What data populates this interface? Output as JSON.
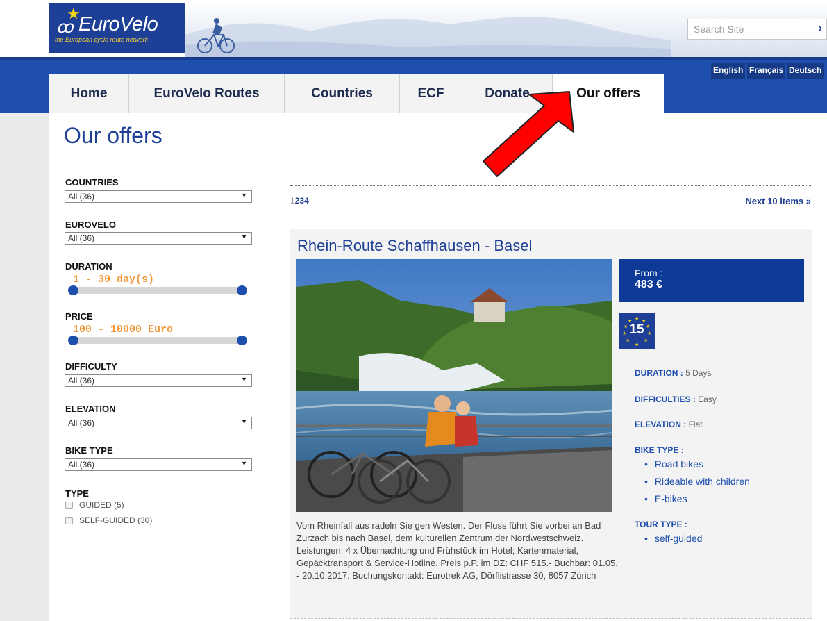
{
  "header": {
    "logo_text": "EuroVelo",
    "logo_tagline": "the European cycle route network",
    "search_placeholder": "Search Site",
    "languages": [
      "English",
      "Français",
      "Deutsch"
    ]
  },
  "nav": {
    "items": [
      {
        "label": "Home"
      },
      {
        "label": "EuroVelo Routes"
      },
      {
        "label": "Countries"
      },
      {
        "label": "ECF"
      },
      {
        "label": "Donate"
      },
      {
        "label": "Our offers",
        "active": true
      }
    ]
  },
  "page": {
    "title": "Our offers"
  },
  "filters": {
    "countries": {
      "label": "COUNTRIES",
      "value": "All (36)"
    },
    "eurovelo": {
      "label": "EUROVELO",
      "value": "All (36)"
    },
    "duration": {
      "label": "DURATION",
      "range_text": "1 - 30 day(s)",
      "min": 1,
      "max": 30
    },
    "price": {
      "label": "PRICE",
      "range_text": "100 - 10000 Euro",
      "min": 100,
      "max": 10000
    },
    "difficulty": {
      "label": "DIFFICULTY",
      "value": "All (36)"
    },
    "elevation": {
      "label": "ELEVATION",
      "value": "All (36)"
    },
    "bike_type": {
      "label": "BIKE TYPE",
      "value": "All (36)"
    },
    "type": {
      "label": "TYPE",
      "options": [
        {
          "label": "GUIDED (5)",
          "checked": false
        },
        {
          "label": "SELF-GUIDED (30)",
          "checked": false
        }
      ]
    }
  },
  "results": {
    "pages": [
      "1",
      "2",
      "3",
      "4"
    ],
    "current_page": "1",
    "next_label": "Next 10 items »"
  },
  "offer": {
    "title": "Rhein-Route Schaffhausen - Basel",
    "price_from_label": "From :",
    "price": "483 €",
    "eurovelo_number": "15",
    "duration_label": "DURATION :",
    "duration_value": "5 Days",
    "difficulties_label": "DIFFICULTIES :",
    "difficulties_value": "Easy",
    "elevation_label": "ELEVATION :",
    "elevation_value": "Flat",
    "bike_type_label": "BIKE TYPE :",
    "bike_types": [
      "Road bikes",
      "Rideable with children",
      "E-bikes"
    ],
    "tour_type_label": "TOUR TYPE :",
    "tour_types": [
      "self-guided"
    ],
    "description": "Vom Rheinfall aus radeln Sie gen Westen. Der Fluss führt Sie vorbei an Bad Zurzach bis nach Basel, dem kulturellen Zentrum der Nordwestschweiz. Leistungen: 4 x Übernachtung und Frühstück im Hotel; Kartenmaterial, Gepäcktransport & Service-Hotline. Preis p.P. im DZ: CHF 515.- Buchbar: 01.05. - 20.10.2017. Buchungskontakt: Eurotrek AG, Dörflistrasse 30, 8057 Zürich"
  },
  "colors": {
    "brand_blue": "#1e4fae",
    "dark_blue": "#0c3a96",
    "accent_orange": "#f29a3c",
    "annotation_red": "#ff0000"
  }
}
